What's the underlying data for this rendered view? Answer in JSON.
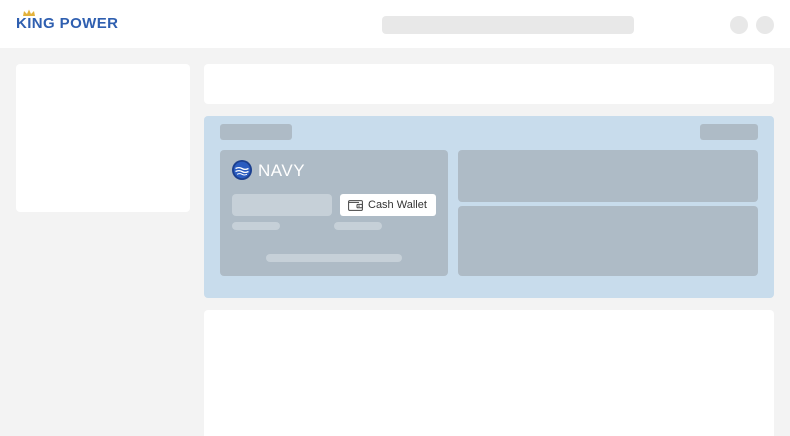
{
  "header": {
    "logo_text": "KING POWER",
    "brand_color": "#2f5fb0",
    "crown_color": "#e3b23c"
  },
  "membership": {
    "tier_name": "NAVY",
    "tier_icon": "navy-tier-badge-icon",
    "wallet_button_label": "Cash Wallet",
    "wallet_icon": "wallet-icon"
  },
  "colors": {
    "page_background": "#f3f3f3",
    "panel_background": "#c8dcec",
    "skeleton": "#aebbc6"
  }
}
